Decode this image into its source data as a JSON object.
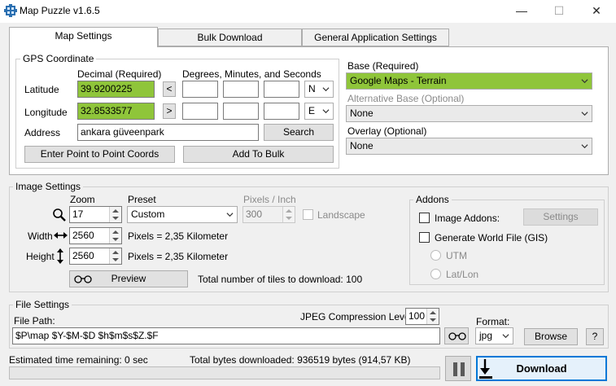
{
  "window": {
    "title": "Map Puzzle v1.6.5",
    "minimize_glyph": "—",
    "maximize_glyph": "☐",
    "close_glyph": "✕"
  },
  "tabs": [
    {
      "label": "Map Settings",
      "active": true
    },
    {
      "label": "Bulk Download",
      "active": false
    },
    {
      "label": "General Application Settings",
      "active": false
    }
  ],
  "gps": {
    "group_title": "GPS Coordinate",
    "decimal_header": "Decimal (Required)",
    "dms_header": "Degrees, Minutes, and Seconds",
    "latitude_label": "Latitude",
    "latitude_value": "39.9200225",
    "latitude_arrow": "<",
    "latitude_hemisphere": "N",
    "longitude_label": "Longitude",
    "longitude_value": "32.8533577",
    "longitude_arrow": ">",
    "longitude_hemisphere": "E",
    "address_label": "Address",
    "address_value": "ankara güveenpark",
    "search_button": "Search",
    "p2p_button": "Enter Point to Point Coords",
    "bulk_button": "Add To Bulk"
  },
  "layers": {
    "base_label": "Base (Required)",
    "base_value": "Google Maps - Terrain",
    "alt_label": "Alternative Base (Optional)",
    "alt_value": "None",
    "overlay_label": "Overlay (Optional)",
    "overlay_value": "None"
  },
  "image_settings": {
    "group_title": "Image Settings",
    "zoom_label": "Zoom",
    "zoom_value": "17",
    "preset_label": "Preset",
    "preset_value": "Custom",
    "ppi_label": "Pixels / Inch",
    "ppi_value": "300",
    "landscape_label": "Landscape",
    "width_label": "Width",
    "width_value": "2560",
    "width_info": "Pixels = 2,35 Kilometer",
    "height_label": "Height",
    "height_value": "2560",
    "height_info": "Pixels = 2,35 Kilometer",
    "preview_button": "Preview",
    "tiles_text": "Total number of tiles to download: 100"
  },
  "addons": {
    "group_title": "Addons",
    "image_addons_label": "Image Addons:",
    "settings_button": "Settings",
    "world_file_label": "Generate World File (GIS)",
    "utm_label": "UTM",
    "latlon_label": "Lat/Lon"
  },
  "file_settings": {
    "group_title": "File Settings",
    "path_label": "File Path:",
    "path_value": "$P\\map $Y-$M-$D $h$m$s$Z.$F",
    "jpeg_label": "JPEG Compression Level",
    "jpeg_value": "100",
    "format_label": "Format:",
    "format_value": "jpg",
    "browse_button": "Browse",
    "help_button": "?"
  },
  "status": {
    "time_remaining": "Estimated time remaining: 0 sec",
    "bytes_downloaded": "Total bytes downloaded: 936519 bytes (914,57 KB)",
    "progress": 0,
    "download_button": "Download"
  },
  "colors": {
    "accent_green": "#8fc53a",
    "download_border": "#0078d7"
  }
}
